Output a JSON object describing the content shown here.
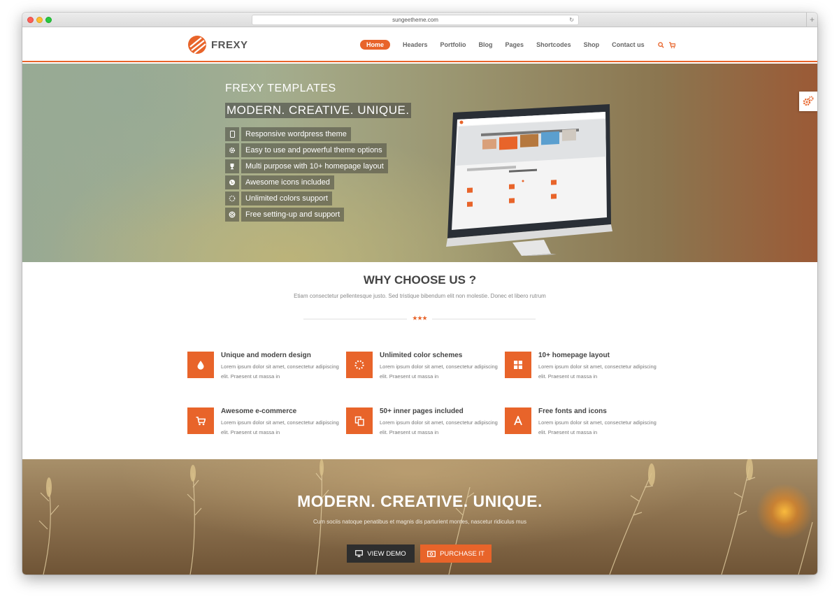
{
  "browser": {
    "url": "sungeetheme.com",
    "reload_icon": "reload-icon",
    "newtab_label": "+"
  },
  "header": {
    "logo_text": "FREXY",
    "nav": [
      {
        "label": "Home",
        "active": true
      },
      {
        "label": "Headers"
      },
      {
        "label": "Portfolio"
      },
      {
        "label": "Blog"
      },
      {
        "label": "Pages"
      },
      {
        "label": "Shortcodes"
      },
      {
        "label": "Shop"
      },
      {
        "label": "Contact us"
      }
    ],
    "icons": [
      "search-icon",
      "cart-icon"
    ]
  },
  "hero": {
    "title": "FREXY TEMPLATES",
    "tagline": "MODERN. CREATIVE. UNIQUE.",
    "features": [
      {
        "icon": "tablet-icon",
        "label": "Responsive wordpress theme"
      },
      {
        "icon": "gear-icon",
        "label": "Easy to use and powerful theme options"
      },
      {
        "icon": "trophy-icon",
        "label": "Multi purpose with 10+ homepage layout"
      },
      {
        "icon": "globe-icon",
        "label": "Awesome icons included"
      },
      {
        "icon": "spinner-icon",
        "label": "Unlimited colors support"
      },
      {
        "icon": "support-icon",
        "label": "Free setting-up and support"
      }
    ]
  },
  "why": {
    "title": "WHY CHOOSE US ?",
    "subtitle": "Etiam consectetur pellentesque justo. Sed tristique bibendum elit non molestie. Donec et libero rutrum",
    "stars": "★★★",
    "cards": [
      {
        "icon": "drop-icon",
        "title": "Unique and modern design",
        "text": "Lorem ipsum dolor sit amet, consectetur adipiscing elit. Praesent ut massa in"
      },
      {
        "icon": "spinner-icon",
        "title": "Unlimited color schemes",
        "text": "Lorem ipsum dolor sit amet, consectetur adipiscing elit. Praesent ut massa in"
      },
      {
        "icon": "grid-icon",
        "title": "10+ homepage layout",
        "text": "Lorem ipsum dolor sit amet, consectetur adipiscing elit. Praesent ut massa in"
      },
      {
        "icon": "cart-icon",
        "title": "Awesome e-commerce",
        "text": "Lorem ipsum dolor sit amet, consectetur adipiscing elit. Praesent ut massa in"
      },
      {
        "icon": "copy-icon",
        "title": "50+ inner pages included",
        "text": "Lorem ipsum dolor sit amet, consectetur adipiscing elit. Praesent ut massa in"
      },
      {
        "icon": "font-icon",
        "title": "Free fonts and icons",
        "text": "Lorem ipsum dolor sit amet, consectetur adipiscing elit. Praesent ut massa in"
      }
    ]
  },
  "banner": {
    "title": "MODERN. CREATIVE. UNIQUE.",
    "subtitle": "Cum sociis natoque penatibus et magnis dis parturient montes, nascetur ridiculus mus",
    "view_demo": "VIEW DEMO",
    "purchase": "PURCHASE IT"
  },
  "colors": {
    "accent": "#e8642a",
    "dark_button": "#2e2e2e",
    "text": "#444444"
  }
}
